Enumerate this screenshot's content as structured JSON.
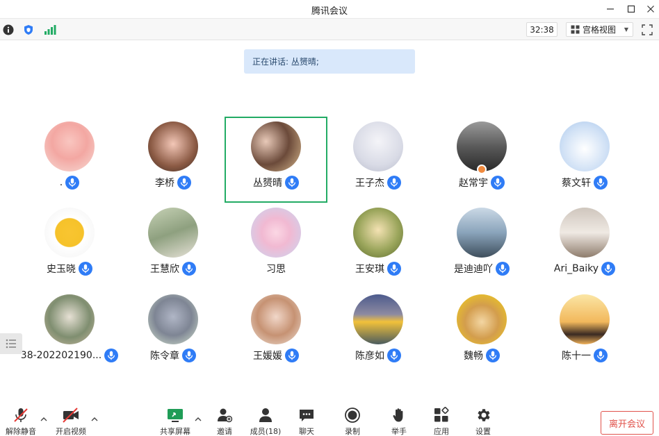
{
  "window": {
    "title": "腾讯会议"
  },
  "toolbar": {
    "timer": "32:38",
    "view_label": "宫格视图"
  },
  "speaking": {
    "text": "正在讲话: 丛赟晴;"
  },
  "participants": [
    {
      "name": "."
    },
    {
      "name": "李桥"
    },
    {
      "name": "丛赟晴"
    },
    {
      "name": "王子杰"
    },
    {
      "name": "赵常宇"
    },
    {
      "name": "蔡文轩"
    },
    {
      "name": "史玉晓"
    },
    {
      "name": "王慧欣"
    },
    {
      "name": "习思"
    },
    {
      "name": "王安琪"
    },
    {
      "name": "是迪迪吖"
    },
    {
      "name": "Ari_Baiky"
    },
    {
      "name": "38-202202190..."
    },
    {
      "name": "陈令章"
    },
    {
      "name": "王媛媛"
    },
    {
      "name": "陈彦如"
    },
    {
      "name": "魏畅"
    },
    {
      "name": "陈十一"
    }
  ],
  "bottom": {
    "unmute": "解除静音",
    "video": "开启视频",
    "share": "共享屏幕",
    "invite": "邀请",
    "members": "成员(18)",
    "chat": "聊天",
    "record": "录制",
    "raise_hand": "举手",
    "apps": "应用",
    "settings": "设置",
    "leave": "离开会议"
  },
  "colors": {
    "accent": "#2f7cf6",
    "active_border": "#22ab64",
    "leave": "#e0514a",
    "speaking_bg": "#d9e8fb"
  }
}
